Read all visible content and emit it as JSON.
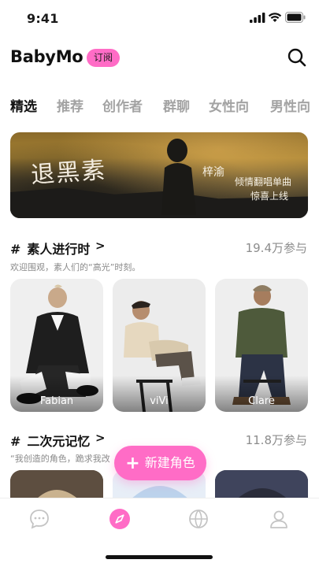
{
  "status_bar": {
    "time": "9:41"
  },
  "header": {
    "logo": "BabyMo",
    "subscribe_label": "订阅"
  },
  "tabs": [
    "精选",
    "推荐",
    "创作者",
    "群聊",
    "女性向",
    "男性向"
  ],
  "banner": {
    "calligraphy": "退黑素",
    "artist": "梓渝",
    "line1": "倾情翻唱单曲",
    "line2": "惊喜上线"
  },
  "section1": {
    "hash": "#",
    "title": "素人进行时",
    "chevron": ">",
    "count": "19.4万参与",
    "desc": "欢迎围观，素人们的“高光”时刻。",
    "cards": [
      {
        "name": "Fabian"
      },
      {
        "name": "viVi"
      },
      {
        "name": "Clare"
      }
    ]
  },
  "section2": {
    "hash": "#",
    "title": "二次元记忆",
    "chevron": ">",
    "count": "11.8万参与",
    "desc": "“我创造的角色，跪求我改"
  },
  "fab": {
    "plus": "+",
    "label": "新建角色"
  },
  "bottom_nav": [
    {
      "icon": "chat-bubble-icon"
    },
    {
      "icon": "explore-icon"
    },
    {
      "icon": "basketball-icon"
    },
    {
      "icon": "profile-icon"
    }
  ],
  "colors": {
    "accent": "#ff6cc6",
    "text": "#141414",
    "muted": "#a3a3a3"
  }
}
